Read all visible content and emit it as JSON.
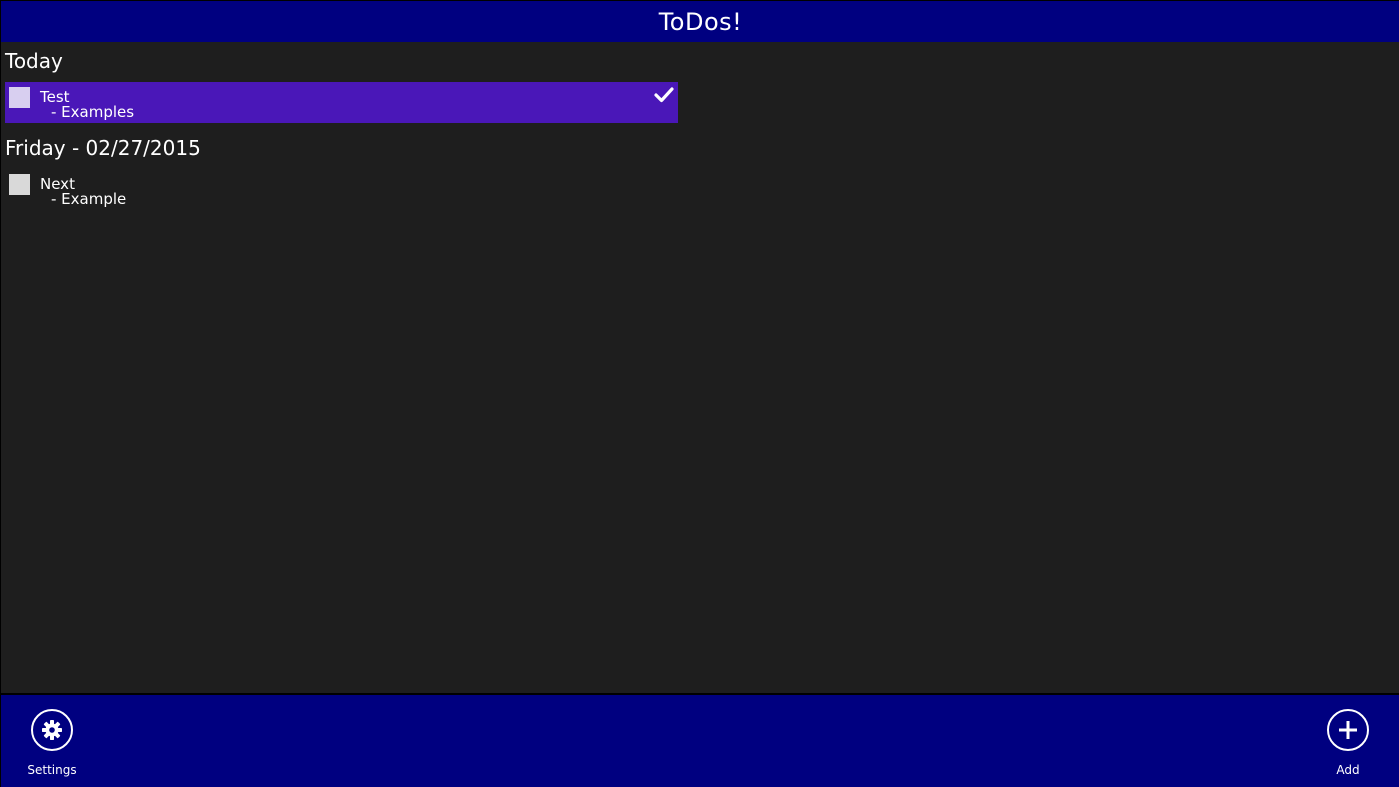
{
  "app": {
    "title": "ToDos!"
  },
  "groups": [
    {
      "header": "Today",
      "items": [
        {
          "title": "Test",
          "subtitle": "- Examples",
          "selected": true
        }
      ]
    },
    {
      "header": "Friday - 02/27/2015",
      "items": [
        {
          "title": "Next",
          "subtitle": "- Example",
          "selected": false
        }
      ]
    }
  ],
  "appbar": {
    "settings_label": "Settings",
    "add_label": "Add"
  },
  "icons": {
    "settings": "gear-icon",
    "add": "plus-icon",
    "check": "checkmark-icon"
  },
  "colors": {
    "header_bg": "#000080",
    "content_bg": "#1e1e1e",
    "selected_bg": "#4a17b8",
    "text": "#ffffff"
  }
}
